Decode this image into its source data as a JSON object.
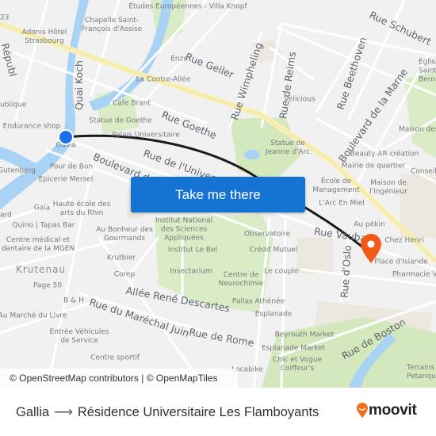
{
  "map": {
    "streets": [
      {
        "key": "quai_koch",
        "label": "Quai Koch"
      },
      {
        "key": "rue_geiler",
        "label": "Rue Geiler"
      },
      {
        "key": "rue_wimpheling",
        "label": "Rue Wimpheling"
      },
      {
        "key": "rue_de_reims",
        "label": "Rue de Reims"
      },
      {
        "key": "rue_beethoven",
        "label": "Rue Beethoven"
      },
      {
        "key": "rue_schubert",
        "label": "Rue Schubert"
      },
      {
        "key": "bd_marne",
        "label": "Boulevard de la Marne"
      },
      {
        "key": "rue_goethe",
        "label": "Rue Goethe"
      },
      {
        "key": "rue_universite",
        "label": "Rue de l'Université"
      },
      {
        "key": "boulevard",
        "label": "Boulevard de"
      },
      {
        "key": "rue_vauban",
        "label": "Rue Vauban"
      },
      {
        "key": "rue_oslo",
        "label": "Rue d'Oslo"
      },
      {
        "key": "allee_descartes",
        "label": "Allée René Descartes"
      },
      {
        "key": "rue_marechal_juin",
        "label": "Rue du Maréchal Juin"
      },
      {
        "key": "rue_de_rome",
        "label": "Rue de Rome"
      },
      {
        "key": "rue_de_boston",
        "label": "Rue de Boston"
      },
      {
        "key": "rue_republique",
        "label": "Républ"
      }
    ],
    "district": "Krutenau",
    "pois": [
      "Études Européennes - Villa Knopf",
      "Chapelle Saint-François d'Assise",
      "Adonis Hôtel Strasbourg",
      "Enzo",
      "La Contre-Allée",
      "Velicious",
      "Église Saint-Bernard",
      "Cafe Brant",
      "Statue de Goethe",
      "Palais Universitaire",
      "Endurance shop",
      "ublique",
      "Statue de Jeanne d'Arc",
      "Maison des",
      "Beauty AR création",
      "Mairie de quartier",
      "Conseil",
      "École de Management",
      "Maison de l'ingénieur",
      "L'Arc En Miel",
      "Pour de Bon",
      "Épicerie Mersel",
      "Gutenberg",
      "Gaïa",
      "Haute école des arts du Rhin",
      "Institut National des Sciences Appliquées",
      "Observatoire",
      "Au pékin",
      "Chez Henri",
      "Place d'Islande",
      "Pharmacie Va",
      "Quino | Tapas Bar",
      "Au Bonheur des Gourmands",
      "Centre médical et dentaire de la MGEN",
      "Institut Le Bel",
      "Crédit Mutuel",
      "Krutbier",
      "Corep",
      "Insectarium",
      "Centre de Neurochimie",
      "Le couple",
      "Page 50",
      "B & H",
      "Pallas Athénée",
      "Esplanade",
      "Au Marché du Livre",
      "Entrée Véhicules de Service",
      "Beyrouth Market",
      "Esplanade Market",
      "Chic et Vogue Coiffeur's",
      "Centre sportif",
      "Locabike",
      "Terrains de Petanque",
      "Gallia",
      "ard",
      "23"
    ],
    "origin_label": "Gallia",
    "cta_label": "Take me there",
    "attribution": "© OpenStreetMap contributors | © OpenMapTiles",
    "colors": {
      "water": "#a9d3f5",
      "park": "#cfe8b7",
      "major_road": "#f9f0b5",
      "route": "#1a1a1a",
      "cta": "#1473d3",
      "origin": "#1e6ff0",
      "destination": "#f25a17"
    }
  },
  "footer": {
    "origin": "Gallia",
    "arrow": "⟶",
    "destination": "Résidence Universitaire Les Flamboyants",
    "brand": "moovit",
    "brand_color": "#f26a1b"
  }
}
